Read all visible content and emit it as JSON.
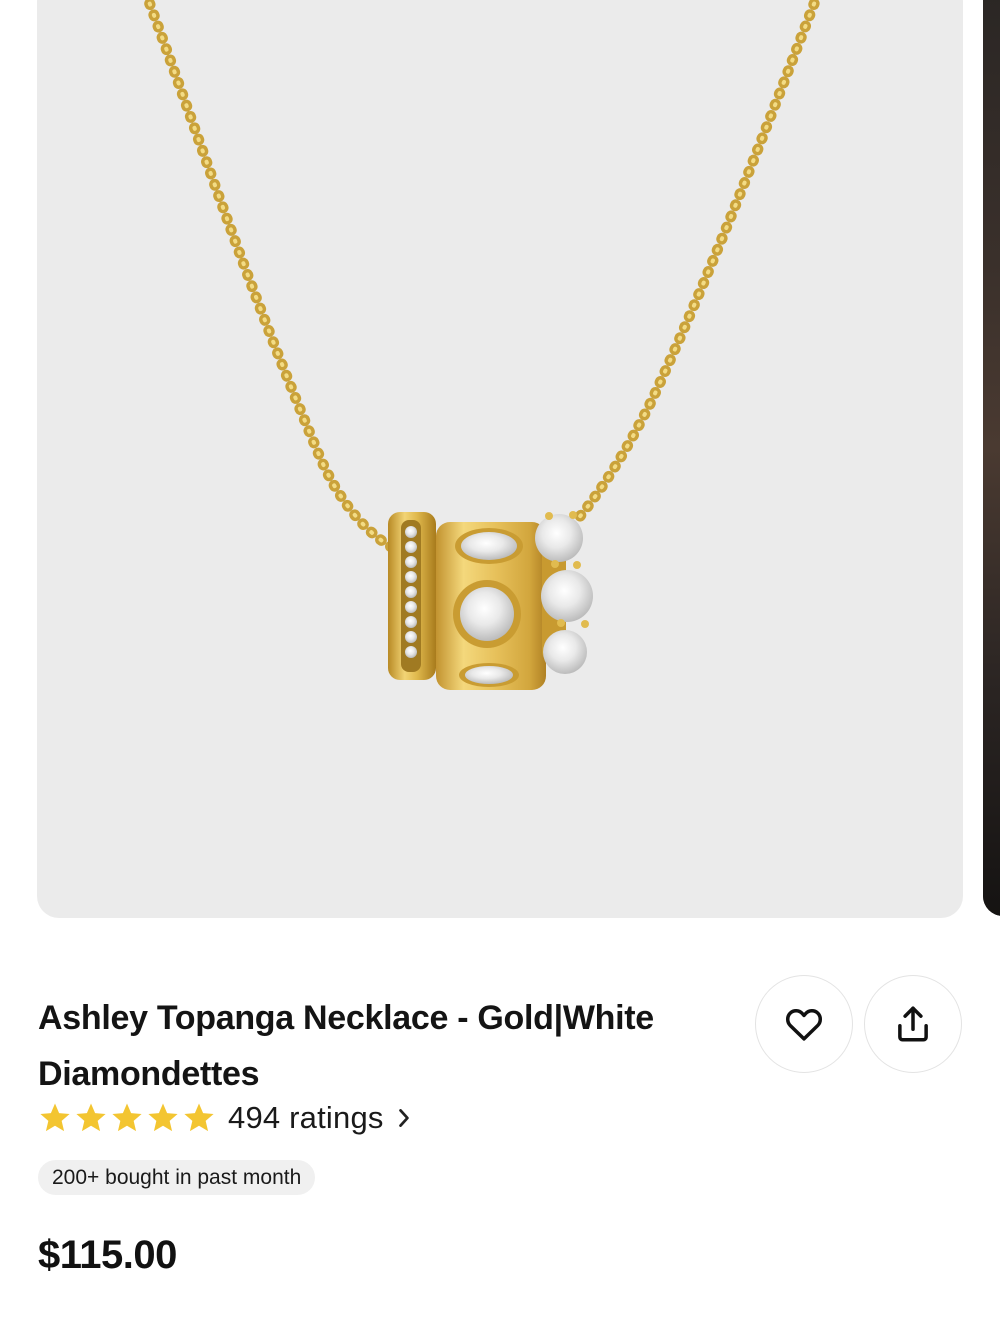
{
  "product": {
    "title": "Ashley Topanga Necklace - Gold|White Diamondettes",
    "price": "$115.00",
    "rating_value": 5,
    "rating_max": 5,
    "ratings_label": "494 ratings",
    "bought_badge": "200+ bought in past month"
  },
  "images": {
    "main": "gold-necklace-with-stacked-pendant-rings",
    "next": "model-wearing-necklace"
  },
  "icons": {
    "favorite": "heart-icon",
    "share": "share-icon",
    "star": "star-icon",
    "chevron": "chevron-right-icon"
  },
  "colors": {
    "image_background": "#ebebeb",
    "star": "#f3c531",
    "gold": "#d9b44a",
    "text": "#141414",
    "badge_background": "#f0f0f0"
  }
}
